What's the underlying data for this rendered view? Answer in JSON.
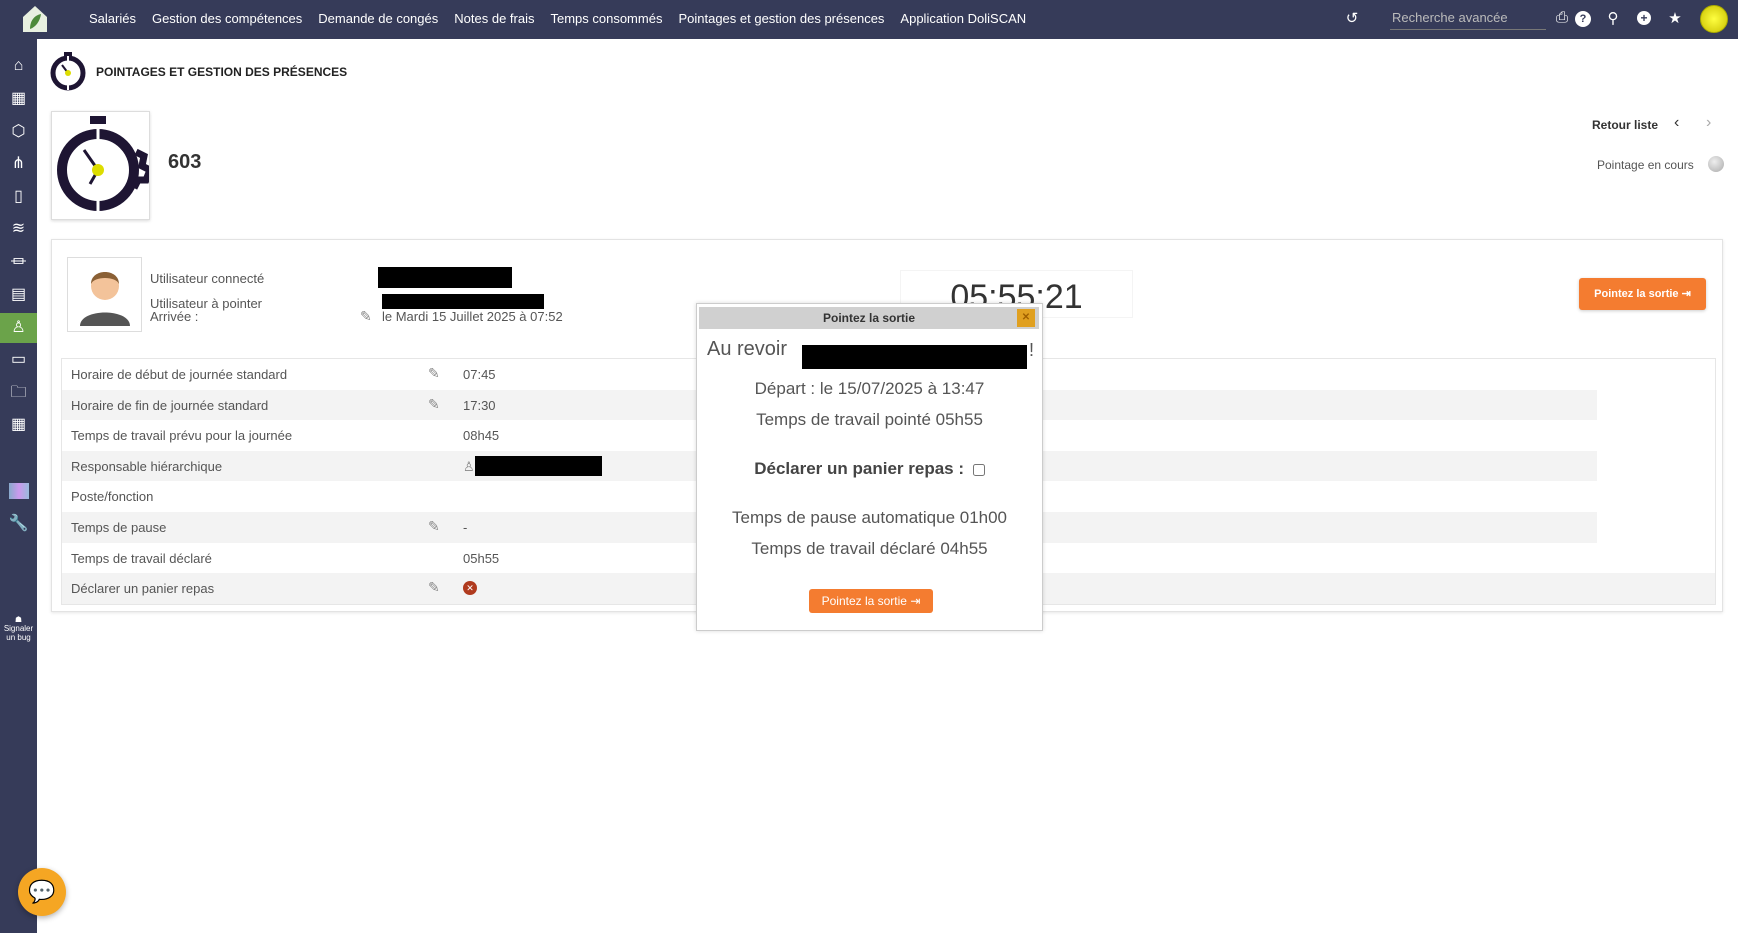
{
  "topbar": {
    "nav": [
      "Salariés",
      "Gestion des compétences",
      "Demande de congés",
      "Notes de frais",
      "Temps consommés",
      "Pointages et gestion des présences",
      "Application DoliSCAN"
    ],
    "search_placeholder": "Recherche avancée"
  },
  "sidebar": {
    "bug_label_1": "Signaler",
    "bug_label_2": "un bug"
  },
  "page": {
    "title": "POINTAGES ET GESTION DES PRÉSENCES",
    "ref": "603",
    "back_label": "Retour liste",
    "status_label": "Pointage en cours"
  },
  "user": {
    "connected_label": "Utilisateur connecté",
    "to_clock_label": "Utilisateur à pointer",
    "arrival_label": "Arrivée :",
    "arrival_value": "le Mardi 15 Juillet 2025 à 07:52"
  },
  "clock": "05:55:21",
  "clock_out_button": "Pointez la sortie",
  "fields": [
    {
      "label": "Horaire de début de journée standard",
      "value": "07:45",
      "editable": true
    },
    {
      "label": "Horaire de fin de journée standard",
      "value": "17:30",
      "editable": true
    },
    {
      "label": "Temps de travail prévu pour la journée",
      "value": "08h45",
      "editable": false
    },
    {
      "label": "Responsable hiérarchique",
      "value": "",
      "editable": false
    },
    {
      "label": "Poste/fonction",
      "value": "",
      "editable": false
    },
    {
      "label": "Temps de pause",
      "value": "-",
      "editable": true
    },
    {
      "label": "Temps de travail déclaré",
      "value": "05h55",
      "editable": false
    },
    {
      "label": "Déclarer un panier repas",
      "value": "",
      "editable": true
    }
  ],
  "dialog": {
    "title": "Pointez la sortie",
    "greeting": "Au revoir",
    "exclamation": "!",
    "departure": "Départ : le 15/07/2025 à 13:47",
    "worked": "Temps de travail pointé 05h55",
    "meal_label": "Déclarer un panier repas :",
    "auto_pause": "Temps de pause automatique 01h00",
    "declared": "Temps de travail déclaré 04h55",
    "button": "Pointez la sortie"
  },
  "colors": {
    "topbar": "#363b59",
    "accent": "#f47c30",
    "active": "#6ba34a"
  }
}
